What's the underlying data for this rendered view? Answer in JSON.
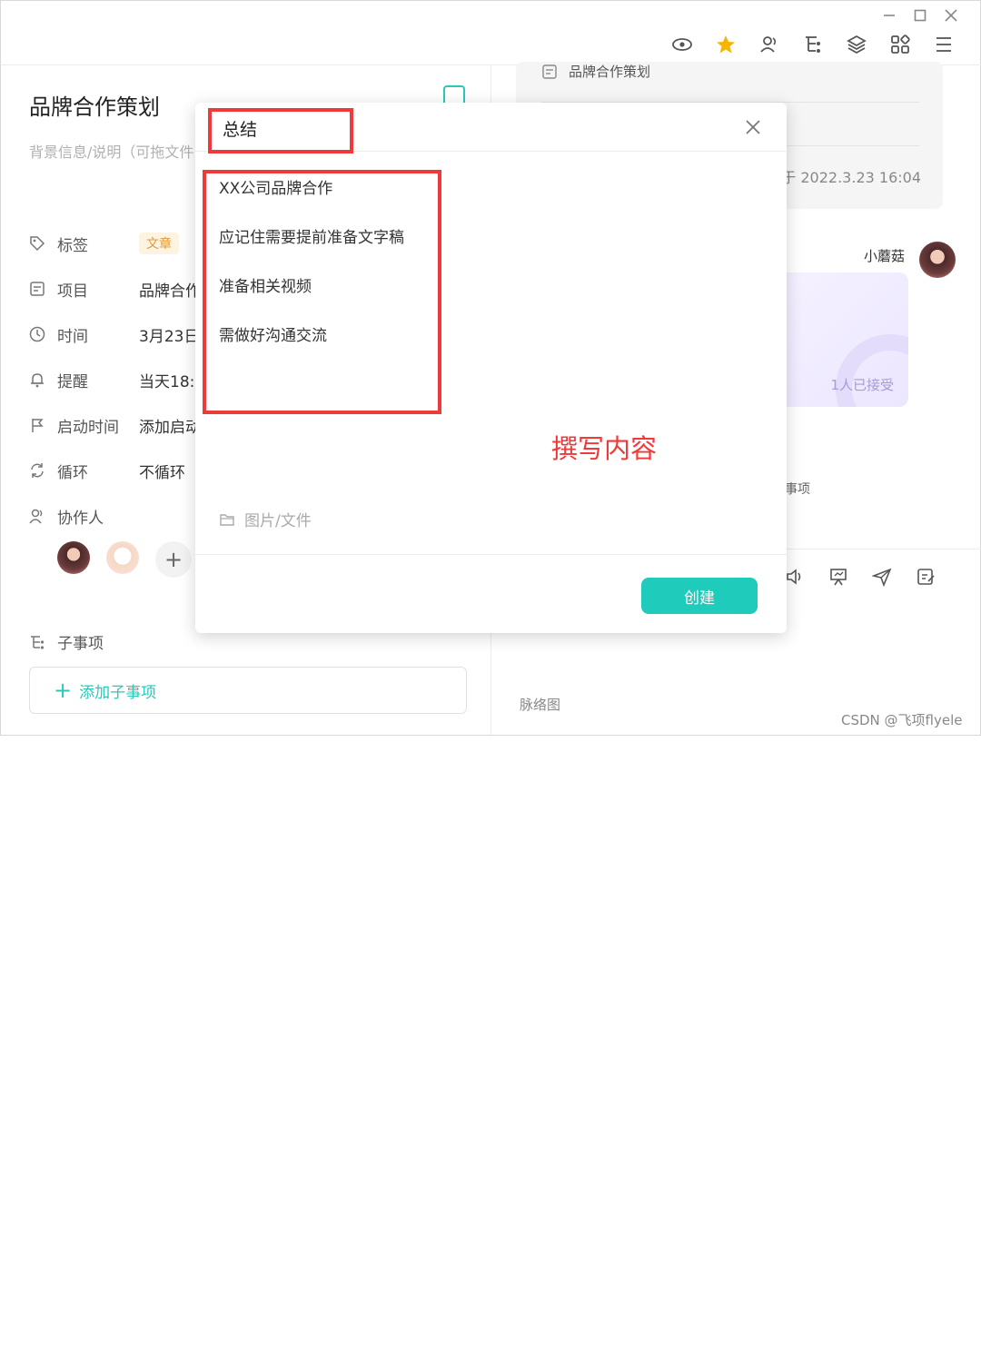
{
  "task": {
    "title": "品牌合作策划",
    "description": "背景信息/说明（可拖文件",
    "fields": [
      {
        "label": "标签",
        "value": "文章",
        "icon": "tag-icon"
      },
      {
        "label": "项目",
        "value": "品牌合作",
        "icon": "project-icon"
      },
      {
        "label": "时间",
        "value": "3月23日",
        "icon": "clock-icon"
      },
      {
        "label": "提醒",
        "value": "当天18:0",
        "icon": "bell-icon"
      },
      {
        "label": "启动时间",
        "value": "添加启动",
        "icon": "flag-icon"
      },
      {
        "label": "循环",
        "value": "不循环",
        "icon": "repeat-icon"
      },
      {
        "label": "协作人",
        "value": "",
        "icon": "people-icon"
      }
    ],
    "subtasks_label": "子事项",
    "mindmap_link": "脉络图",
    "add_subtask": "添加子事项"
  },
  "right_panel": {
    "project_name": "品牌合作策划",
    "created_text": "建于 2022.3.23 16:04",
    "username": "小蘑菇",
    "card_status": "1人已接受",
    "mini_text": "事项",
    "watermark": "CSDN @飞项flyele"
  },
  "modal": {
    "title": "总结",
    "content_lines": [
      "XX公司品牌合作",
      "应记住需要提前准备文字稿",
      "准备相关视频",
      "需做好沟通交流"
    ],
    "attachment_label": "图片/文件",
    "create_button": "创建"
  },
  "annotation": {
    "text": "撰写内容",
    "color": "#ee3a3a"
  },
  "colors": {
    "accent": "#1fcbbb",
    "tag_text": "#e29a3a",
    "star": "#f7b500"
  }
}
